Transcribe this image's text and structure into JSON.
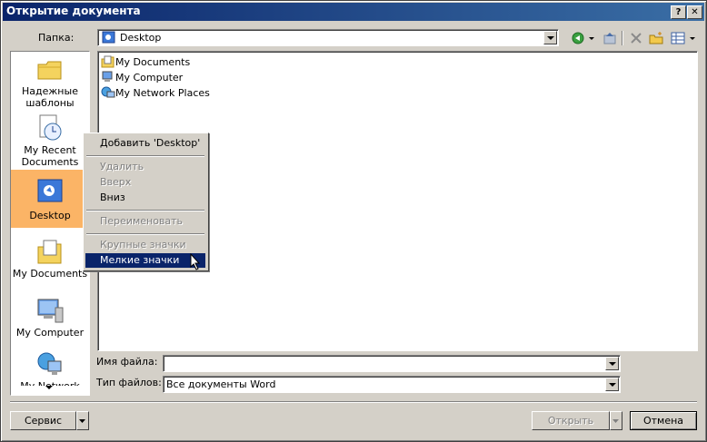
{
  "window": {
    "title": "Открытие документа",
    "help_btn": "?",
    "close_btn": "✕"
  },
  "lookin": {
    "label": "Папка:",
    "value": "Desktop"
  },
  "places": [
    {
      "label": "Надежные шаблоны",
      "icon": "folder-icon"
    },
    {
      "label": "My Recent Documents",
      "icon": "recent-documents-icon"
    },
    {
      "label": "Desktop",
      "icon": "desktop-icon"
    },
    {
      "label": "My Documents",
      "icon": "my-documents-icon"
    },
    {
      "label": "My Computer",
      "icon": "my-computer-icon"
    },
    {
      "label": "My Network Places",
      "icon": "network-places-icon"
    }
  ],
  "files": [
    {
      "name": "My Documents",
      "icon": "my-documents-icon"
    },
    {
      "name": "My Computer",
      "icon": "my-computer-icon"
    },
    {
      "name": "My Network Places",
      "icon": "network-places-icon"
    }
  ],
  "context_menu": {
    "add": "Добавить 'Desktop'",
    "delete": "Удалить",
    "up": "Вверх",
    "down": "Вниз",
    "rename": "Переименовать",
    "large_icons": "Крупные значки",
    "small_icons": "Мелкие значки"
  },
  "filename": {
    "label": "Имя файла:",
    "value": ""
  },
  "filetype": {
    "label": "Тип файлов:",
    "value": "Все документы Word"
  },
  "buttons": {
    "tools": "Сервис",
    "open": "Открыть",
    "cancel": "Отмена"
  },
  "colors": {
    "title_start": "#0a246a",
    "title_end": "#3a6ea5",
    "selected_place": "#fbb466",
    "menu_highlight": "#0a246a"
  }
}
